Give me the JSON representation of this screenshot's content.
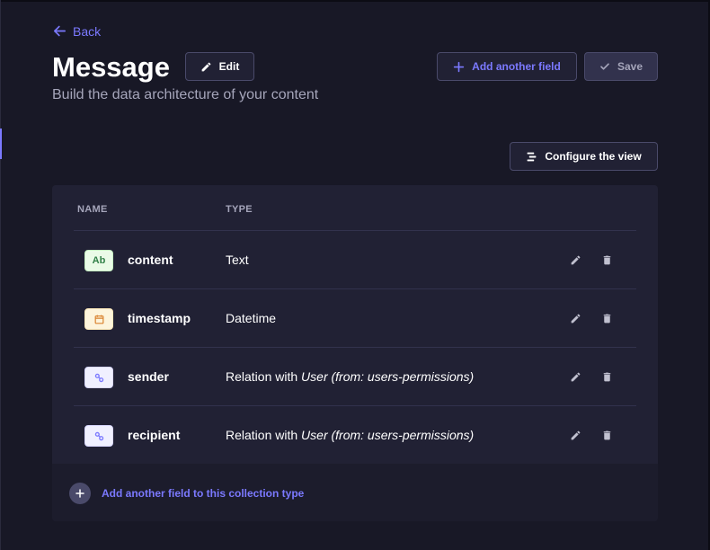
{
  "header": {
    "back_label": "Back",
    "title": "Message",
    "edit_label": "Edit",
    "subtitle": "Build the data architecture of your content",
    "add_field_label": "Add another field",
    "save_label": "Save",
    "configure_label": "Configure the view"
  },
  "table": {
    "columns": [
      "NAME",
      "TYPE"
    ],
    "rows": [
      {
        "badge": "Ab",
        "badge_kind": "text",
        "name": "content",
        "type_prefix": "Text",
        "type_target": "",
        "type_suffix": ""
      },
      {
        "badge": "calendar-icon",
        "badge_kind": "date",
        "name": "timestamp",
        "type_prefix": "Datetime",
        "type_target": "",
        "type_suffix": ""
      },
      {
        "badge": "link-icon",
        "badge_kind": "relation",
        "name": "sender",
        "type_prefix": "Relation with ",
        "type_target": "User (from: users-permissions)",
        "type_suffix": ""
      },
      {
        "badge": "link-icon",
        "badge_kind": "relation",
        "name": "recipient",
        "type_prefix": "Relation with ",
        "type_target": "User (from: users-permissions)",
        "type_suffix": ""
      }
    ],
    "footer_label": "Add another field to this collection type"
  },
  "colors": {
    "accent": "#7b79ff",
    "background": "#181826",
    "card": "#212134"
  }
}
